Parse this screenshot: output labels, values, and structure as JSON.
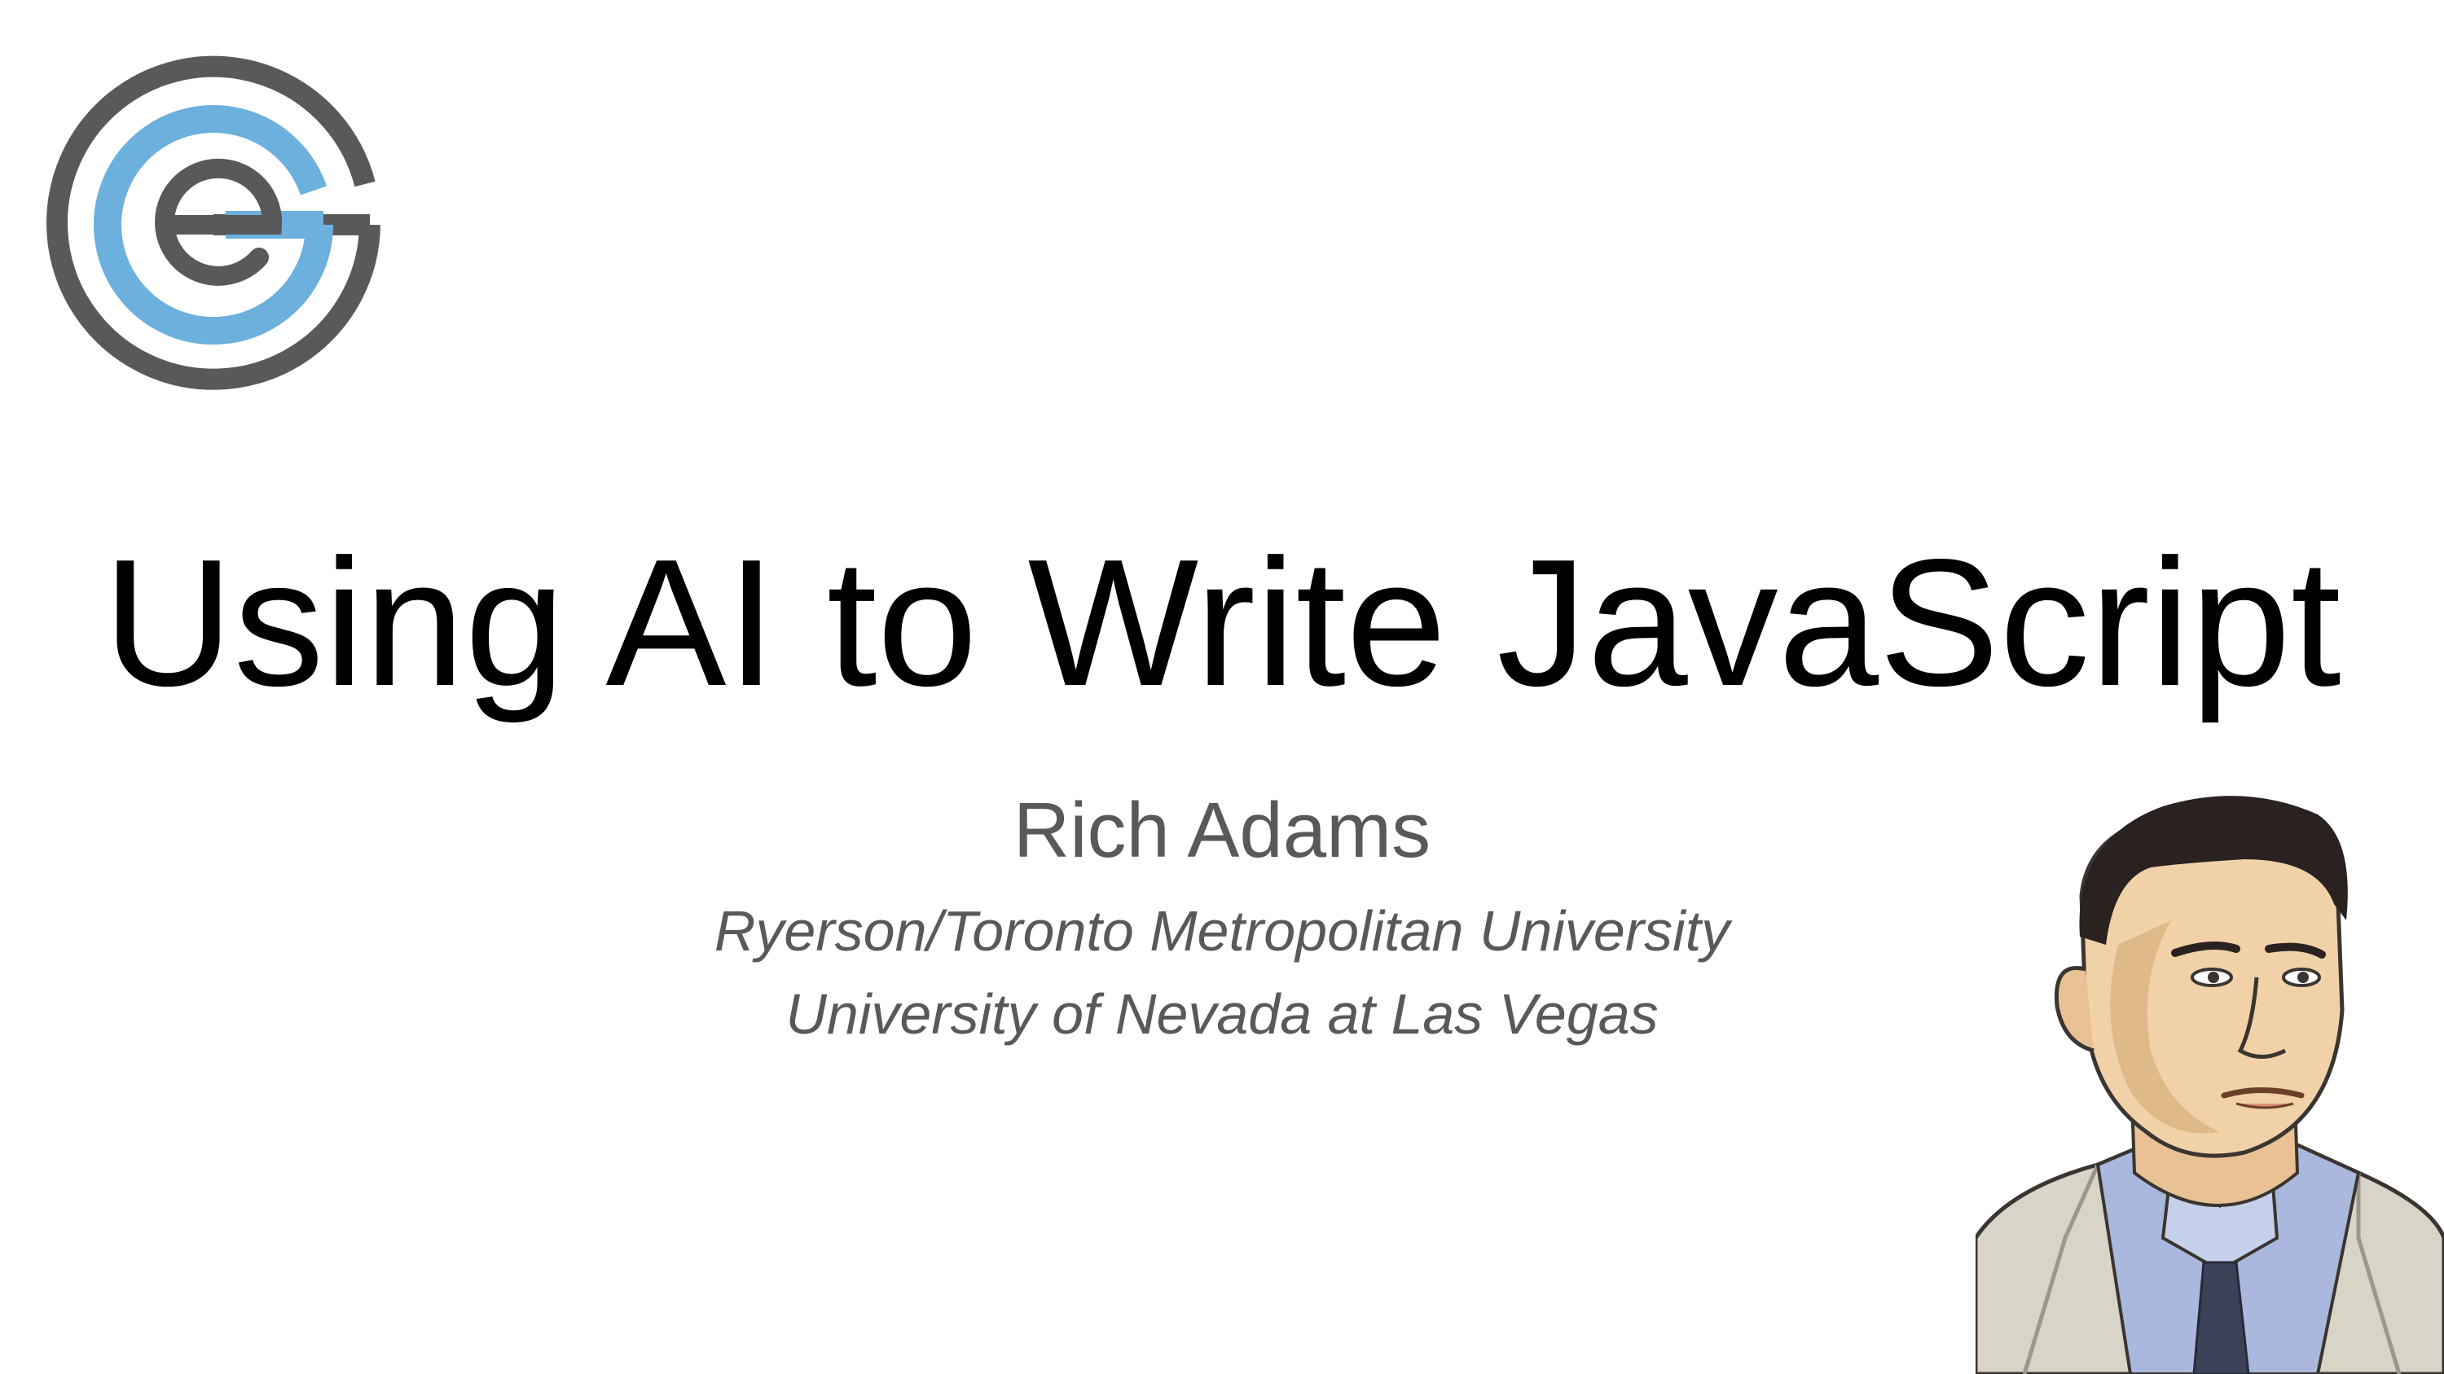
{
  "slide": {
    "title": "Using AI to Write JavaScript",
    "author": "Rich Adams",
    "affiliations": [
      "Ryerson/Toronto Metropolitan University",
      "University of Nevada at Las Vegas"
    ]
  },
  "logo": {
    "icon": "ge-rings-logo",
    "colors": {
      "outer": "#58595b",
      "inner": "#6cb0dd"
    }
  },
  "portrait": {
    "icon": "man-portrait-illustration",
    "colors": {
      "suit": "#d8d4c8",
      "shirt": "#a9b8dc",
      "hair": "#2a2220",
      "skin": "#f1d2a8"
    }
  }
}
